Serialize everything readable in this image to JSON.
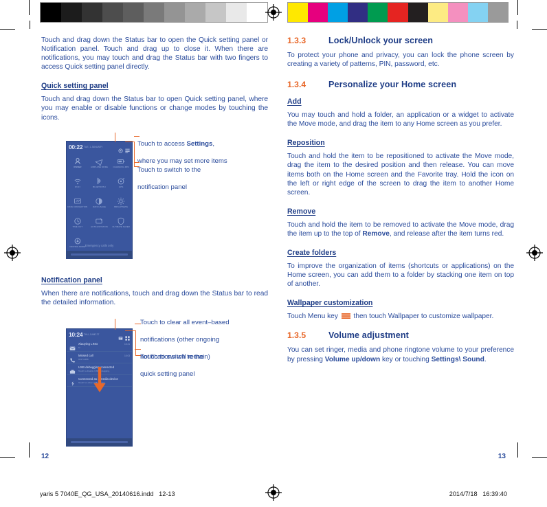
{
  "document": {
    "page_left": "12",
    "page_right": "13",
    "slug_left": "yaris 5 7040E_QG_USA_20140616.indd   12-13",
    "slug_right": "2014/7/18   16:39:40"
  },
  "colors": {
    "body_blue": "#2a4b9b",
    "heading_blue": "#1f3d86",
    "accent_orange": "#e8682a",
    "phone_bg": "#3a569e"
  },
  "calibration": {
    "grayscale": [
      "#000000",
      "#1c1c1c",
      "#333333",
      "#4d4d4d",
      "#5e5e5e",
      "#7a7a7a",
      "#949494",
      "#aaaaaa",
      "#c6c6c6",
      "#e9e9e9",
      "#ffffff"
    ],
    "colors": [
      "#ffe800",
      "#e6007e",
      "#00a0e4",
      "#312e83",
      "#009b50",
      "#e52421",
      "#231f20",
      "#fdeb83",
      "#f490bf",
      "#84d2f2",
      "#9a9a9a"
    ]
  },
  "left_column": {
    "intro": "Touch and drag down the Status bar to open the Quick setting panel or Notification panel. Touch and drag up to close it. When there are notifications, you may touch and drag the Status bar with two fingers to access Quick setting panel directly.",
    "quick_heading": "Quick setting panel",
    "quick_body": "Touch and drag down the Status bar to open Quick setting panel, where you may enable or disable functions or change modes by touching the icons.",
    "notification_heading": "Notification panel",
    "notification_body": "When there are notifications, touch and drag down the Status bar to read the detailed information."
  },
  "right_column": {
    "sections": [
      {
        "num": "1.3.3",
        "title": "Lock/Unlock your screen"
      },
      {
        "num": "1.3.4",
        "title": "Personalize your Home screen"
      },
      {
        "num": "1.3.5",
        "title": "Volume adjustment"
      }
    ],
    "lock_body": "To protect your phone and privacy, you can lock the phone screen by creating a variety of patterns, PIN, password, etc.",
    "add_heading": "Add",
    "add_body": "You may touch and hold a folder, an application or a widget to activate the Move mode, and drag the item to any Home screen as you prefer.",
    "reposition_heading": "Reposition",
    "reposition_body": "Touch and hold the item to be repositioned to activate the Move mode, drag the item to the desired position and then release. You can move items both on the Home screen and the Favorite tray. Hold the icon on the left or right edge of the screen to drag the item to another Home screen.",
    "remove_heading": "Remove",
    "remove_body_1": "Touch and hold the item to be removed to activate the Move mode, drag the item up to the top of ",
    "remove_bold": "Remove",
    "remove_body_2": ", and release after the item turns red.",
    "folders_heading": "Create folders",
    "folders_body": "To improve the organization of items (shortcuts or applications) on the Home screen, you can add them to a folder by stacking one item on top of another.",
    "wallpaper_heading": "Wallpaper customization",
    "wallpaper_body_1": "Touch Menu key ",
    "wallpaper_body_2": " then touch Wallpaper to customize wallpaper.",
    "volume_body_1": "You can set ringer, media and phone ringtone volume to your preference by pressing ",
    "volume_bold_1": "Volume up/down",
    "volume_body_2": " key or touching ",
    "volume_bold_2": "Settings\\ Sound",
    "volume_body_3": "."
  },
  "figure_quick": {
    "status_time": "00:22",
    "status_date": "TUE, 1 JANUARY",
    "tiles": [
      {
        "label": "OWNER",
        "icon": "user-icon"
      },
      {
        "label": "AIRPLANE MODE",
        "icon": "airplane-icon"
      },
      {
        "label": "CHARGING 48%",
        "icon": "battery-icon"
      },
      {
        "label": "WI-FI",
        "icon": "wifi-icon"
      },
      {
        "label": "BLUETOOTH",
        "icon": "bluetooth-icon"
      },
      {
        "label": "GPS",
        "icon": "gps-icon"
      },
      {
        "label": "DATA CONNECTION",
        "icon": "data-connection-icon"
      },
      {
        "label": "DATA USAGE",
        "icon": "data-usage-icon"
      },
      {
        "label": "BRIGHTNESS",
        "icon": "brightness-icon"
      },
      {
        "label": "TIME OUT",
        "icon": "timeout-icon"
      },
      {
        "label": "AUTO-ROTATION",
        "icon": "autorotate-icon"
      },
      {
        "label": "ULTIMATE SAVER",
        "icon": "ultimate-saver-icon"
      },
      {
        "label": "DRIVING MODE",
        "icon": "driving-mode-icon"
      }
    ],
    "emergency": "Emergency calls only"
  },
  "figure_notification": {
    "status_time": "10:24",
    "status_date": "THU, JUNE 27",
    "notifications": [
      {
        "title": "Xiaoying LING",
        "subtitle": "hi",
        "time": "10:21",
        "icon": "message-icon"
      },
      {
        "title": "Missed call",
        "subtitle": "021 51488",
        "time": "10:03",
        "icon": "missed-call-icon"
      },
      {
        "title": "USB debugging connected",
        "subtitle": "Touch to disable USB debugging.",
        "time": "",
        "icon": "usb-icon"
      },
      {
        "title": "Connected as a media device",
        "subtitle": "Touch for other USB options.",
        "time": "",
        "icon": "media-device-icon"
      }
    ]
  },
  "callouts_quick": [
    {
      "line1": "Touch to access ",
      "bold": "Settings",
      "line1b": ",",
      "line2": "where you may set more items"
    },
    {
      "line1": "Touch to switch to the",
      "line2": "notification panel"
    }
  ],
  "callouts_notification": [
    {
      "line1": "Touch to clear all event–based",
      "line2": "notifications (other ongoing",
      "line3": "notifications will remain)"
    },
    {
      "line1": "Touch to switch to the",
      "line2": "quick setting panel"
    }
  ]
}
